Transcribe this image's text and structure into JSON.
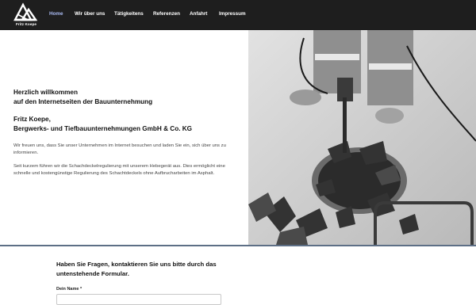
{
  "brand": {
    "name": "Fritz Koepe"
  },
  "nav": {
    "items": [
      {
        "label": "Home",
        "active": true
      },
      {
        "label": "Wir über uns",
        "active": false
      },
      {
        "label": "Tätigkeitens",
        "active": false
      },
      {
        "label": "Referenzen",
        "active": false
      },
      {
        "label": "Anfahrt",
        "active": false
      },
      {
        "label": "Impressum",
        "active": false
      }
    ]
  },
  "hero": {
    "welcome_line1": "Herzlich willkommen",
    "welcome_line2": "auf den Internetseiten der Bauunternehmung",
    "company_line1": "Fritz Koepe,",
    "company_line2": "Bergwerks- und Tiefbauunternehmungen GmbH & Co. KG",
    "paragraph1": "Wir freuen uns, dass Sie unser Unternehmen im Internet besuchen und laden Sie ein, sich über uns zu informieren.",
    "paragraph2": "Seit kurzem führen wir die Schachdeckelregulierung mit unserem Hebegerät aus. Dies ermöglicht eine schnelle und kostengünstige Regulierung des Schachtdeckels ohne Aufbrucharbeiten im Asphalt."
  },
  "contact": {
    "title": "Haben Sie Fragen, kontaktieren Sie uns bitte durch das untenstehende Formular.",
    "name_label": "Dein Name *",
    "name_value": ""
  },
  "colors": {
    "nav_bg": "#1e1e1e",
    "active_link": "#a8b9f0",
    "divider": "#5d6f86"
  }
}
